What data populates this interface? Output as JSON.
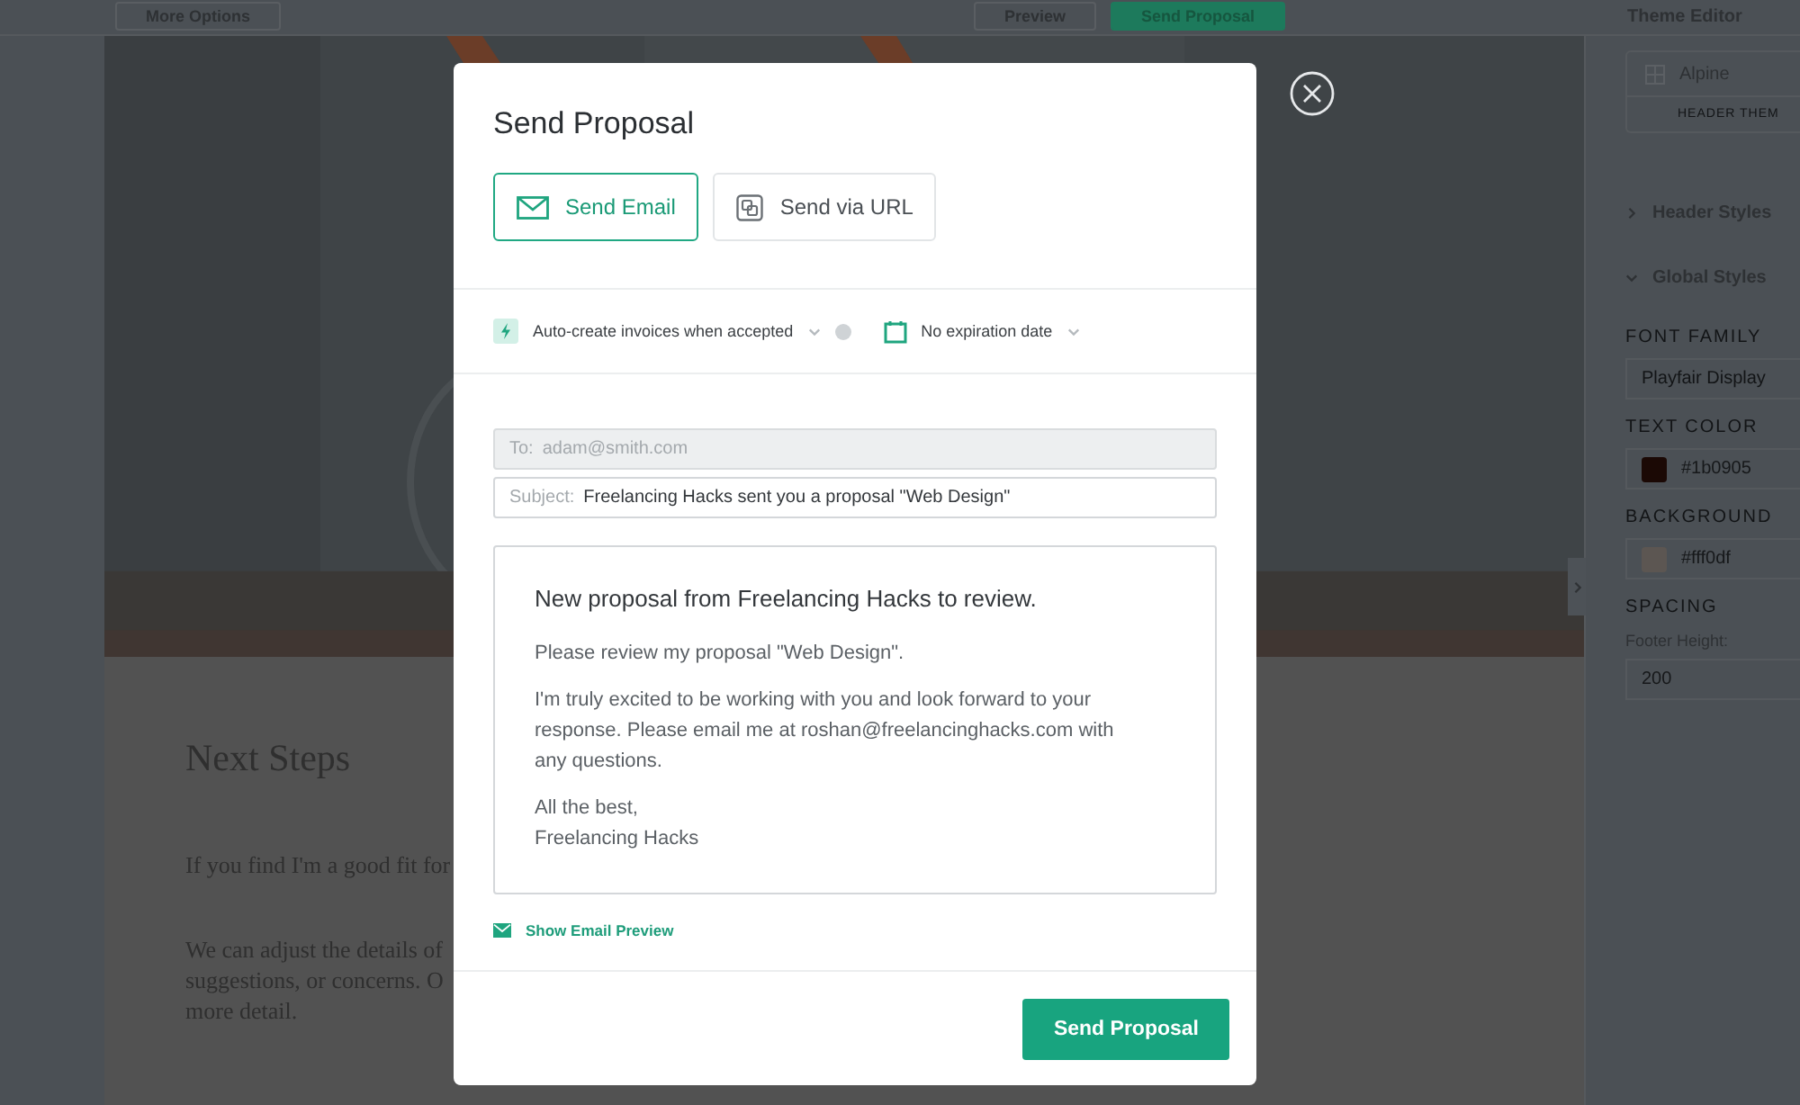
{
  "top_bar": {
    "left_button": "More Options",
    "right_buttons": [
      {
        "label": "Preview",
        "kind": "outline"
      },
      {
        "label": "Send Proposal",
        "kind": "primary"
      }
    ]
  },
  "document": {
    "heading": "Next Steps",
    "paragraphs": [
      [
        "If you find I'm a good fit for"
      ],
      [
        "We can adjust the details of",
        "suggestions, or concerns. O",
        "more detail."
      ]
    ]
  },
  "theme_editor": {
    "title": "Theme Editor",
    "theme": {
      "name": "Alpine",
      "caption": "HEADER THEM"
    },
    "sections": [
      {
        "label": "Header Styles",
        "expanded": false
      },
      {
        "label": "Global Styles",
        "expanded": true
      }
    ],
    "font_family": {
      "label": "FONT FAMILY",
      "value": "Playfair Display"
    },
    "text_color": {
      "label": "TEXT COLOR",
      "value": "#1b0905",
      "color": "#1b0905"
    },
    "background": {
      "label": "BACKGROUND",
      "value": "#fff0df",
      "color": "#5c5652"
    },
    "spacing": {
      "label": "SPACING",
      "field_label": "Footer Height:",
      "value": "200"
    }
  },
  "modal": {
    "title": "Send Proposal",
    "tabs": [
      {
        "label": "Send Email",
        "kind": "email",
        "selected": true
      },
      {
        "label": "Send via URL",
        "kind": "url",
        "selected": false
      }
    ],
    "options": [
      {
        "label": "Auto-create invoices when accepted",
        "kind": "invoice"
      },
      {
        "label": "No expiration date",
        "kind": "expiry"
      }
    ],
    "to": {
      "label": "To:",
      "value": "adam@smith.com",
      "disabled": true
    },
    "subject": {
      "label": "Subject:",
      "value": "Freelancing Hacks sent you a proposal \"Web Design\""
    },
    "message": {
      "heading": "New proposal from Freelancing Hacks to review.",
      "paragraphs": [
        [
          "Please review my proposal \"Web Design\"."
        ],
        [
          "I'm truly excited to be working with you and look forward to your",
          "response. Please email me at roshan@freelancinghacks.com with",
          "any questions."
        ],
        [
          "All the best,",
          "Freelancing Hacks"
        ]
      ]
    },
    "preview_link": "Show Email Preview",
    "submit": "Send Proposal"
  }
}
